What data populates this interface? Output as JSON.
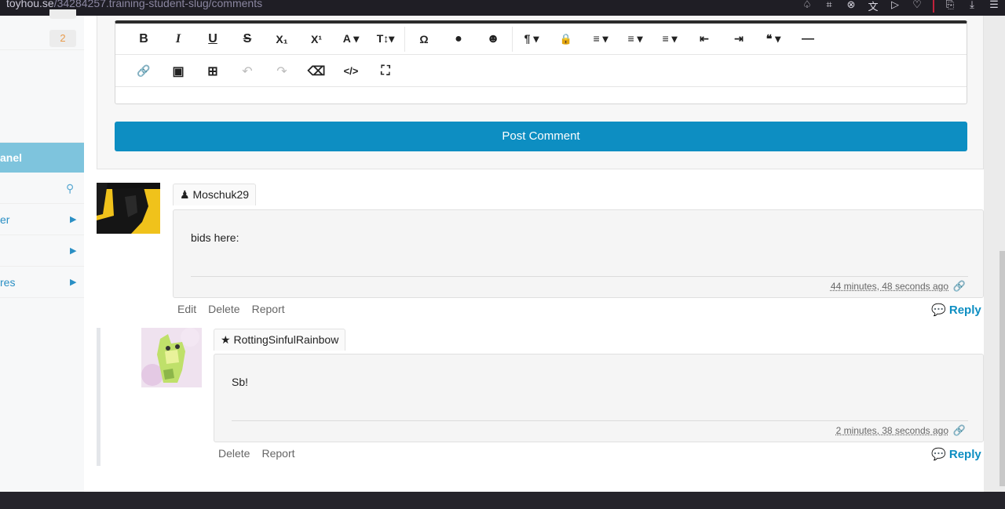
{
  "browser": {
    "url_host": "toyhou.se",
    "url_path": "/34284257.training-student-slug/comments",
    "icons": [
      "bell-icon",
      "crop-icon",
      "close-circle-icon",
      "translate-icon",
      "send-icon",
      "heart-icon",
      "account-icon",
      "download-icon",
      "menu-icon"
    ]
  },
  "sidebar": {
    "badge": "2",
    "panel_label": "anel",
    "items": [
      {
        "label": "",
        "icon": "pin-icon"
      },
      {
        "label": "er",
        "icon": "chevron-right-icon"
      },
      {
        "label": "",
        "icon": "chevron-right-icon"
      },
      {
        "label": "res",
        "icon": "chevron-right-icon"
      }
    ]
  },
  "editor": {
    "toolbar_row1": [
      "B",
      "I",
      "U",
      "S",
      "X₁",
      "X¹",
      "A ▾",
      "T↕▾",
      "Ω",
      "●",
      "☻",
      "¶ ▾",
      "🔒",
      "≡ ▾",
      "≡ ▾",
      "≡ ▾",
      "⇤",
      "⇥",
      "❝ ▾",
      "—"
    ],
    "toolbar_row2": [
      "🔗",
      "▣",
      "⊞",
      "↶",
      "↷",
      "⌫",
      "</>",
      "⛶"
    ],
    "post_button": "Post Comment"
  },
  "comments": [
    {
      "username": "Moschuk29",
      "user_icon": "user-icon",
      "text": "bids here:",
      "time": "44 minutes, 48 seconds ago",
      "actions": [
        "Edit",
        "Delete",
        "Report"
      ],
      "reply": "Reply"
    },
    {
      "username": "RottingSinfulRainbow",
      "user_icon": "star-icon",
      "text": "Sb!",
      "time": "2 minutes, 38 seconds ago",
      "actions": [
        "Delete",
        "Report"
      ],
      "reply": "Reply"
    }
  ],
  "colors": {
    "accent": "#0d8ec2",
    "panel_blue": "#7ec4dd",
    "badge_orange": "#e89b4b"
  }
}
